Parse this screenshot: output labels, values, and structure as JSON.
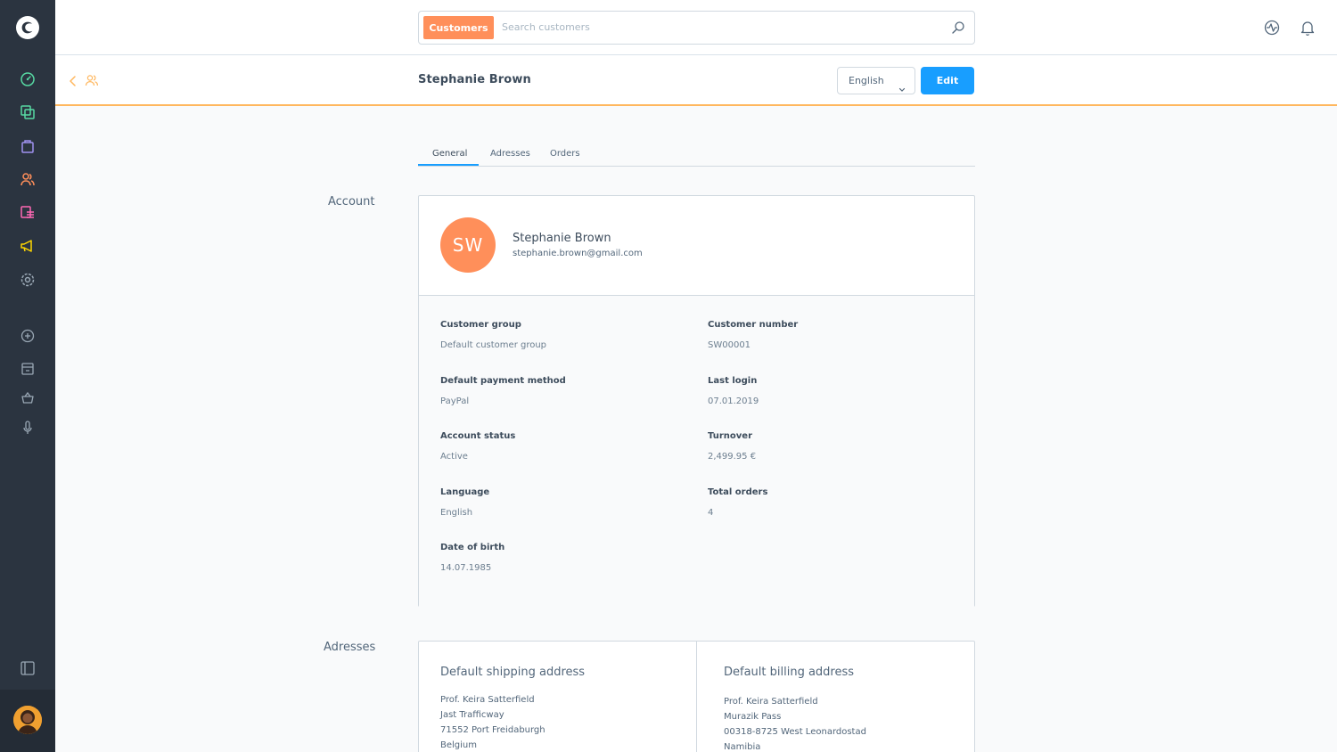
{
  "sidebar": {
    "items": [
      {
        "name": "dashboard",
        "color": "#57d9a3"
      },
      {
        "name": "catalogues",
        "color": "#57d9a3"
      },
      {
        "name": "orders",
        "color": "#a092f0"
      },
      {
        "name": "customers",
        "color": "#ff8f5a"
      },
      {
        "name": "content",
        "color": "#ff68b4"
      },
      {
        "name": "marketing",
        "color": "#ffd700"
      },
      {
        "name": "settings",
        "color": "#9aa8b5"
      }
    ]
  },
  "search": {
    "tag": "Customers",
    "placeholder": "Search customers"
  },
  "header": {
    "title": "Stephanie Brown",
    "language": "English",
    "edit_label": "Edit"
  },
  "tabs": [
    {
      "label": "General",
      "active": true
    },
    {
      "label": "Adresses",
      "active": false
    },
    {
      "label": "Orders",
      "active": false
    }
  ],
  "account": {
    "section_label": "Account",
    "initials": "SW",
    "name": "Stephanie Brown",
    "email": "stephanie.brown@gmail.com",
    "fields": {
      "customer_group": {
        "label": "Customer group",
        "value": "Default customer group"
      },
      "customer_number": {
        "label": "Customer number",
        "value": "SW00001"
      },
      "payment_method": {
        "label": "Default payment method",
        "value": "PayPal"
      },
      "last_login": {
        "label": "Last login",
        "value": "07.01.2019"
      },
      "account_status": {
        "label": "Account status",
        "value": "Active"
      },
      "turnover": {
        "label": "Turnover",
        "value": "2,499.95 €"
      },
      "language": {
        "label": "Language",
        "value": "English"
      },
      "total_orders": {
        "label": "Total orders",
        "value": "4"
      },
      "date_of_birth": {
        "label": "Date of birth",
        "value": "14.07.1985"
      }
    }
  },
  "addresses": {
    "section_label": "Adresses",
    "shipping": {
      "title": "Default shipping address",
      "lines": [
        "Prof. Keira Satterfield",
        "Jast Trafficway",
        "71552 Port Freidaburgh",
        "Belgium"
      ]
    },
    "billing": {
      "title": "Default billing address",
      "lines": [
        "Prof. Keira Satterfield",
        "Murazik Pass",
        "00318-8725 West Leonardostad",
        "Namibia"
      ]
    }
  },
  "colors": {
    "accent": "#189eff",
    "customers": "#ff8f5a",
    "smartbar_border": "#ffb75e",
    "sidebar_bg": "#2b3440"
  }
}
